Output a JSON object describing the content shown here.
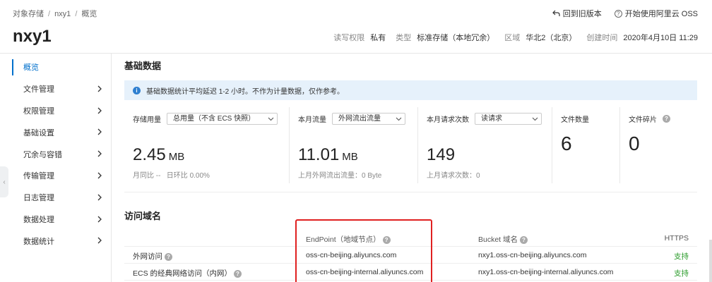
{
  "breadcrumb": [
    "对象存储",
    "nxy1",
    "概览"
  ],
  "top_links": {
    "back": "回到旧版本",
    "start": "开始使用阿里云 OSS"
  },
  "bucket": {
    "name": "nxy1",
    "meta": {
      "rw_label": "读写权限",
      "rw_value": "私有",
      "type_label": "类型",
      "type_value": "标准存储（本地冗余）",
      "region_label": "区域",
      "region_value": "华北2（北京）",
      "created_label": "创建时间",
      "created_value": "2020年4月10日 11:29"
    }
  },
  "sidebar": {
    "items": [
      {
        "label": "概览",
        "has_arrow": false,
        "active": true
      },
      {
        "label": "文件管理",
        "has_arrow": true
      },
      {
        "label": "权限管理",
        "has_arrow": true
      },
      {
        "label": "基础设置",
        "has_arrow": true
      },
      {
        "label": "冗余与容错",
        "has_arrow": true
      },
      {
        "label": "传输管理",
        "has_arrow": true
      },
      {
        "label": "日志管理",
        "has_arrow": true
      },
      {
        "label": "数据处理",
        "has_arrow": true
      },
      {
        "label": "数据统计",
        "has_arrow": true
      }
    ]
  },
  "basic": {
    "title": "基础数据",
    "notice": "基础数据统计平均延迟 1-2 小时。不作为计量数据，仅作参考。",
    "cards": {
      "storage": {
        "label": "存储用量",
        "select": "总用量（不含 ECS 快照）",
        "value": "2.45",
        "unit": "MB",
        "sub_yoy": "月同比 --",
        "sub_mom": "日环比 0.00%"
      },
      "traffic": {
        "label": "本月流量",
        "select": "外网流出流量",
        "value": "11.01",
        "unit": "MB",
        "sub": "上月外网流出流量：0 Byte"
      },
      "requests": {
        "label": "本月请求次数",
        "select": "读请求",
        "value": "149",
        "sub": "上月请求次数：0"
      },
      "files": {
        "label": "文件数量",
        "value": "6"
      },
      "fragments": {
        "label": "文件碎片",
        "value": "0"
      }
    }
  },
  "domains": {
    "title": "访问域名",
    "headers": {
      "endpoint": "EndPoint（地域节点）",
      "bucket": "Bucket 域名",
      "https": "HTTPS"
    },
    "rows": [
      {
        "name": "外网访问",
        "endpoint": "oss-cn-beijing.aliyuncs.com",
        "bucket": "nxy1.oss-cn-beijing.aliyuncs.com",
        "https": "支持"
      },
      {
        "name": "ECS 的经典网络访问（内网）",
        "endpoint": "oss-cn-beijing-internal.aliyuncs.com",
        "bucket": "nxy1.oss-cn-beijing-internal.aliyuncs.com",
        "https": "支持"
      }
    ]
  },
  "colors": {
    "accent": "#0070cc",
    "notice_bg": "#e6f1fb",
    "support": "#2a9b2a",
    "highlight": "#e02020"
  }
}
